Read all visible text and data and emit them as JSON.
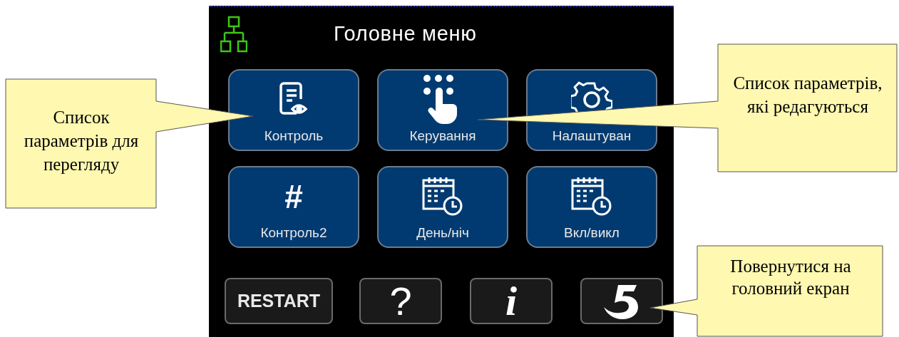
{
  "screen": {
    "title": "Головне меню",
    "menu_buttons": [
      {
        "kind": "document",
        "label": "Контроль"
      },
      {
        "kind": "touch",
        "label": "Керування"
      },
      {
        "kind": "gear",
        "label": "Налаштуван"
      },
      {
        "kind": "symbol",
        "symbol": "#",
        "label": "Контроль2"
      },
      {
        "kind": "calendar",
        "label": "День/ніч"
      },
      {
        "kind": "calendar",
        "label": "Вкл/викл"
      }
    ],
    "bottom_buttons": [
      {
        "kind": "text",
        "label": "RESTART"
      },
      {
        "kind": "question",
        "label": "?"
      },
      {
        "kind": "info",
        "label": "i"
      },
      {
        "kind": "return"
      }
    ]
  },
  "callouts": [
    {
      "text": "Список параметрів для перегляду"
    },
    {
      "text": "Список параметрів, які редагуються"
    },
    {
      "text": "Повернутися на головний екран"
    }
  ]
}
